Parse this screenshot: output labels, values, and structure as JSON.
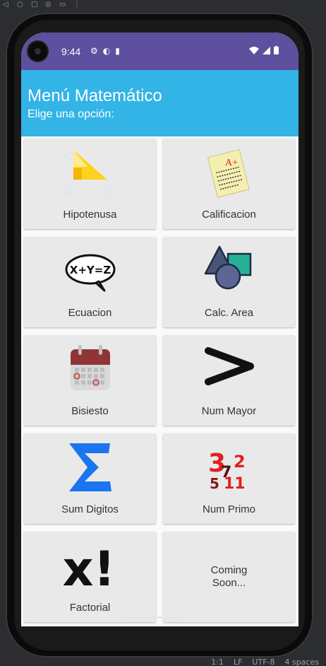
{
  "status_bar": {
    "time": "9:44"
  },
  "header": {
    "title": "Menú Matemático",
    "subtitle": "Elige una opción:"
  },
  "menu": {
    "items": [
      {
        "label": "Hipotenusa",
        "icon": "triangle-abc-icon"
      },
      {
        "label": "Calificacion",
        "icon": "graded-paper-icon",
        "grade": "A+"
      },
      {
        "label": "Ecuacion",
        "icon": "equation-bubble-icon",
        "equation": "X+Y=Z"
      },
      {
        "label": "Calc. Area",
        "icon": "shapes-icon"
      },
      {
        "label": "Bisiesto",
        "icon": "calendar-icon"
      },
      {
        "label": "Num Mayor",
        "icon": "greater-than-icon"
      },
      {
        "label": "Sum Digitos",
        "icon": "sigma-icon"
      },
      {
        "label": "Num Primo",
        "icon": "prime-numbers-icon",
        "numbers": [
          "3",
          "7",
          "2",
          "5",
          "11"
        ]
      },
      {
        "label": "Factorial",
        "icon": "factorial-icon",
        "symbol": "x!"
      },
      {
        "label": "Coming Soon...",
        "icon": ""
      }
    ]
  },
  "ide_status": {
    "position": "1:1",
    "line_ending": "LF",
    "encoding": "UTF-8",
    "indent": "4 spaces"
  },
  "colors": {
    "status_bar": "#5e509e",
    "header": "#32b4e6",
    "card": "#e9e9e9"
  }
}
